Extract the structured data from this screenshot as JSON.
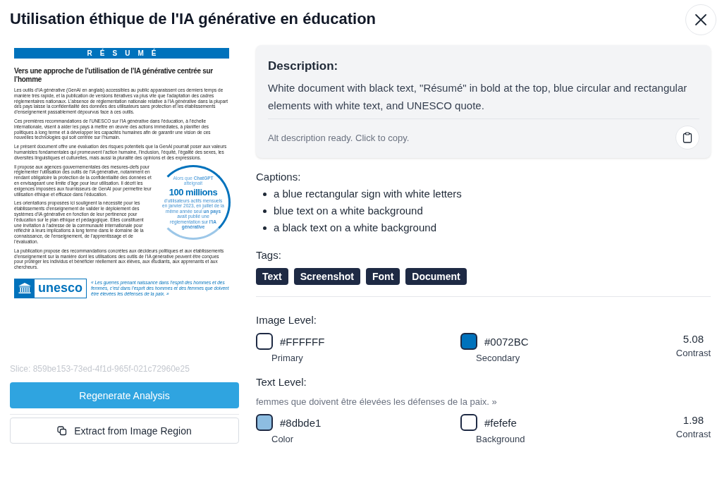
{
  "dialog": {
    "title": "Utilisation éthique de l'IA générative en éducation"
  },
  "document": {
    "banner": "RÉSUMÉ",
    "heading": "Vers une approche de l’utilisation de l’IA générative centrée sur l’homme",
    "paragraphs": [
      "Les outils d’IA générative (GenAI en anglais) accessibles au public apparaissent ces derniers temps de manière très rapide, et la publication de versions itératives va plus vite que l’adaptation des cadres réglementaires nationaux. L’absence de réglementation nationale relative à l’IA générative dans la plupart des pays laisse la confidentialité des données des utilisateurs sans protection et les établissements d’enseignement passablement dépourvus face à ces outils.",
      "Ces premières recommandations de l’UNESCO sur l’IA générative dans l’éducation, à l’échelle internationale, visent à aider les pays à mettre en œuvre des actions immédiates, à planifier des politiques à long terme et à développer les capacités humaines afin de garantir une vision de ces nouvelles technologies qui soit centrée sur l’humain.",
      "Le présent document offre une évaluation des risques potentiels que la GenAI pourrait poser aux valeurs humanistes fondamentales qui promeuvent l’action humaine, l’inclusion, l’équité, l’égalité des sexes, les diversités linguistiques et culturelles, mais aussi la pluralité des opinions et des expressions."
    ],
    "narrow_paragraphs": [
      "Il propose aux agences gouvernementales des mesures-clefs pour réglementer l’utilisation des outils de l’IA générative, notamment en rendant obligatoire la protection de la confidentialité des données et en envisageant une limite d’âge pour leur utilisation. Il décrit les exigences imposées aux fournisseurs de GenAI pour permettre leur utilisation éthique et efficace dans l’éducation.",
      "Les orientations proposées ici soulignent la nécessité pour les établissements d’enseignement de valider le déploiement des systèmes d’IA générative en fonction de leur pertinence pour l’éducation sur le plan éthique et pédagogique. Elles constituent une invitation à l’adresse de la communauté internationale pour réfléchir à leurs implications à long terme dans le domaine de la connaissance, de l’enseignement, de l’apprentissage et de l’évaluation."
    ],
    "closing": "La publication propose des recommandations concrètes aux décideurs politiques et aux établissements d’enseignement sur la manière dont les utilisations des outils de l’IA générative peuvent être conçues pour protéger les individus et bénéficier réellement aux élèves, aux étudiants, aux apprenants et aux chercheurs.",
    "callout": {
      "intro": "Alors que **ChatGPT** atteignait",
      "figure": "100 millions",
      "text": "d’utilisateurs actifs mensuels en janvier 2023, en juillet de la même année seul **un pays** avait publié une réglementation sur **l’IA générative**"
    },
    "logo": "unesco",
    "quote": "« Les guerres prenant naissance dans l’esprit des hommes et des femmes, c’est dans l’esprit des hommes et des femmes que doivent être élevées les défenses de la paix. »"
  },
  "slice": "Slice: 859be153-73ed-4f1d-965f-021c72960e25",
  "buttons": [
    {
      "label": "Regenerate Analysis",
      "kind": "primary"
    },
    {
      "label": "Extract from Image Region",
      "kind": "secondary"
    }
  ],
  "description": {
    "heading": "Description:",
    "text": "White document with black text, \"Résumé\" in bold at the top, blue circular and rectangular elements with white text, and UNESCO quote.",
    "status": "Alt description ready. Click to copy."
  },
  "captions": {
    "heading": "Captions:",
    "items": [
      "a blue rectangular sign with white letters",
      "blue text on a white background",
      "a black text on a white background"
    ]
  },
  "tags": {
    "heading": "Tags:",
    "items": [
      "Text",
      "Screenshot",
      "Font",
      "Document"
    ]
  },
  "image_level": {
    "heading": "Image Level:",
    "swatches": [
      {
        "value": "#FFFFFF",
        "label": "Primary",
        "color": "#ffffff"
      },
      {
        "value": "#0072BC",
        "label": "Secondary",
        "color": "#0072bc"
      }
    ],
    "contrast": {
      "value": "5.08",
      "label": "Contrast"
    }
  },
  "text_level": {
    "heading": "Text Level:",
    "sample": "femmes que doivent être élevées les défenses de la paix. »",
    "swatches": [
      {
        "value": "#8dbde1",
        "label": "Color",
        "color": "#8dbde1"
      },
      {
        "value": "#fefefe",
        "label": "Background",
        "color": "#fefefe"
      }
    ],
    "contrast": {
      "value": "1.98",
      "label": "Contrast"
    }
  }
}
